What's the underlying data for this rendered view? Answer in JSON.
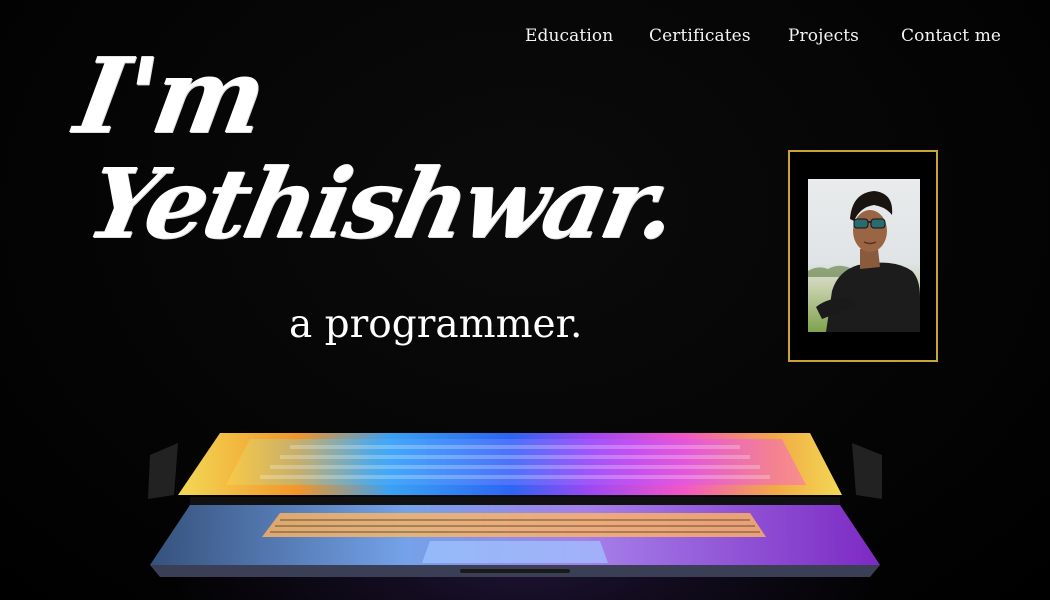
{
  "nav": {
    "items": [
      {
        "label": "Education"
      },
      {
        "label": "Certificates"
      },
      {
        "label": "Projects"
      },
      {
        "label": "Contact me"
      }
    ]
  },
  "hero": {
    "greeting": "I'm",
    "name": "Yethishwar.",
    "role": "a programmer."
  },
  "colors": {
    "background": "#000000",
    "text": "#ffffff",
    "frame_gold": "#c9a537"
  }
}
